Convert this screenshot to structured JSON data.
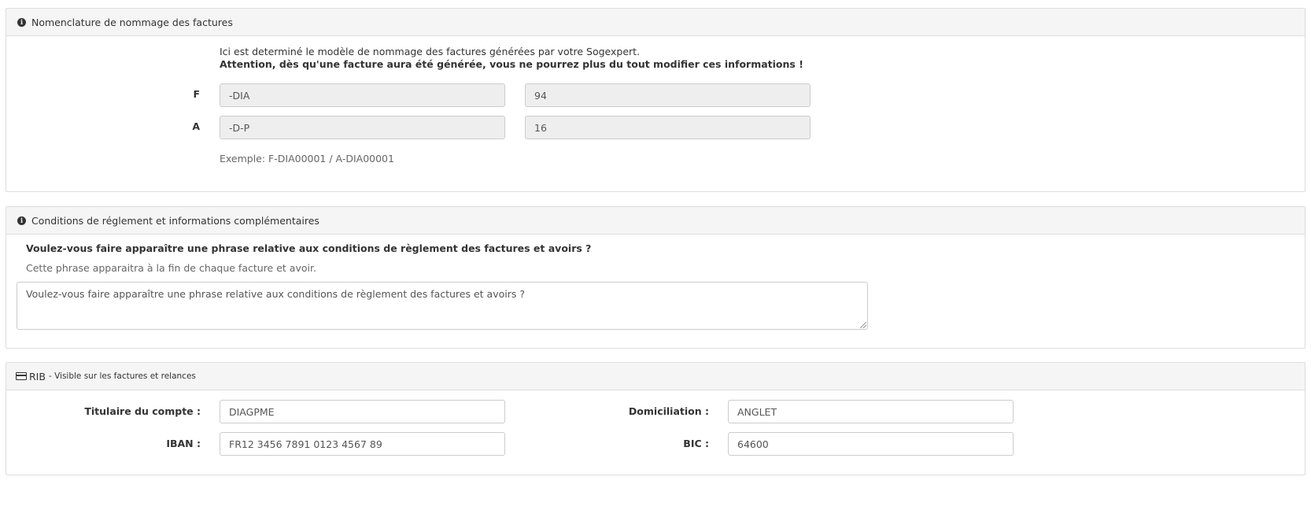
{
  "naming": {
    "title": "Nomenclature de nommage des factures",
    "intro": "Ici est determiné le modèle de nommage des factures générées par votre Sogexpert.",
    "warning": "Attention, dès qu'une facture aura été générée, vous ne pourrez plus du tout modifier ces informations !",
    "rows": [
      {
        "prefix": "F",
        "suffix": "-DIA",
        "counter": "94"
      },
      {
        "prefix": "A",
        "suffix": "-D-P",
        "counter": "16"
      }
    ],
    "example": "Exemple: F-DIA00001 / A-DIA00001"
  },
  "payment": {
    "title": "Conditions de réglement et informations complémentaires",
    "question": "Voulez-vous faire apparaître une phrase relative aux conditions de règlement des factures et avoirs ?",
    "help": "Cette phrase apparaitra à la fin de chaque facture et avoir.",
    "textarea_value": "Voulez-vous faire apparaître une phrase relative aux conditions de règlement des factures et avoirs ?"
  },
  "rib": {
    "title": "RIB",
    "subtitle": "- Visible sur les factures et relances",
    "holder_label": "Titulaire du compte :",
    "holder_value": "DIAGPME",
    "domiciliation_label": "Domiciliation :",
    "domiciliation_value": "ANGLET",
    "iban_label": "IBAN :",
    "iban_value": "FR12 3456 7891 0123 4567 89",
    "bic_label": "BIC :",
    "bic_value": "64600"
  }
}
